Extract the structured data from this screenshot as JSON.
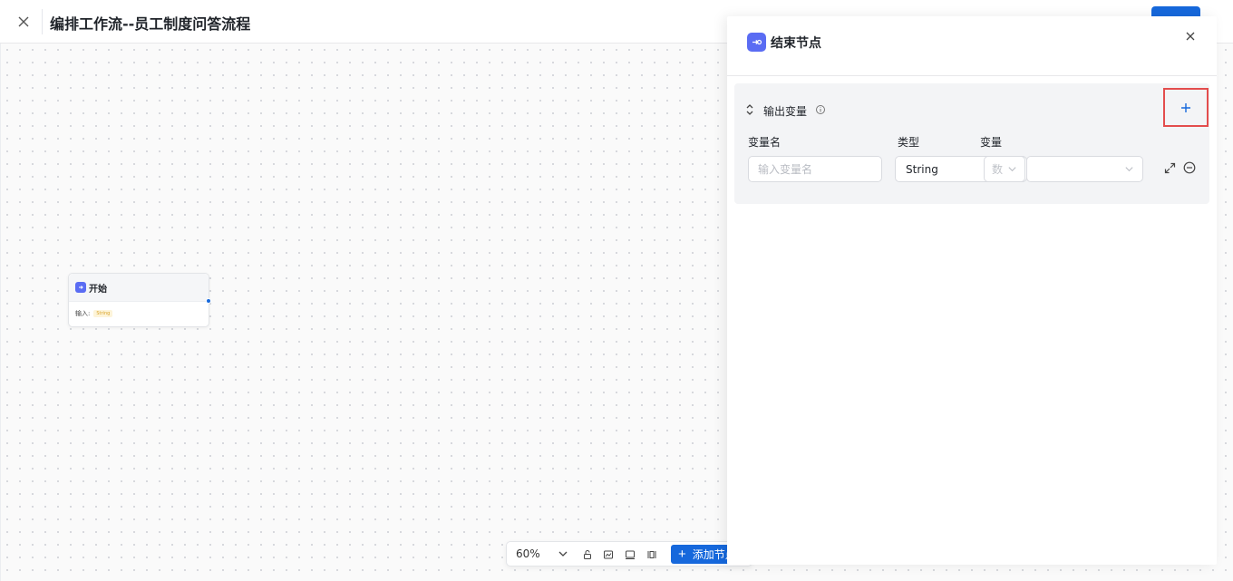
{
  "header": {
    "title": "编排工作流--员工制度问答流程",
    "close_icon": "close-icon",
    "save_color": "#1668dc"
  },
  "canvas": {
    "start_node": {
      "title": "开始",
      "input_label": "输入:",
      "input_tag": "String",
      "icon": "start-node-icon",
      "icon_color": "#5a6cf3"
    }
  },
  "toolbar": {
    "zoom_level": "60%",
    "add_node_label": "添加节点",
    "icons": [
      "lock-icon",
      "minimap-icon",
      "fit-view-icon",
      "layout-icon"
    ]
  },
  "drawer": {
    "title": "结束节点",
    "icon": "end-node-icon",
    "section_title": "输出变量",
    "columns": {
      "name": "变量名",
      "type": "类型",
      "variable": "变量"
    },
    "row": {
      "name_placeholder": "输入变量名",
      "name_value": "",
      "type_value": "String",
      "source_value": "数",
      "variable_value": ""
    },
    "add_variable_icon": "plus-icon",
    "highlight_color": "#e34d4d"
  }
}
